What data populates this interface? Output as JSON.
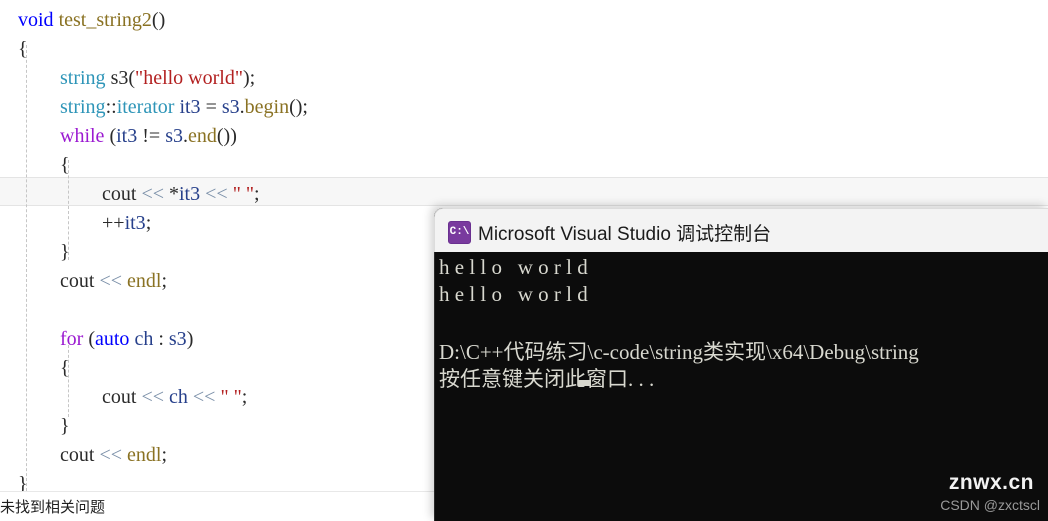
{
  "editor": {
    "language": "cpp",
    "highlighted_line_index": 6,
    "lines": [
      {
        "indent": 0,
        "tokens": [
          {
            "t": "void",
            "c": "kw-blue"
          },
          {
            "t": " ",
            "c": "plain"
          },
          {
            "t": "test_string2",
            "c": "fn-olive"
          },
          {
            "t": "()",
            "c": "punct"
          }
        ]
      },
      {
        "indent": 0,
        "tokens": [
          {
            "t": "{",
            "c": "punct"
          }
        ]
      },
      {
        "indent": 1,
        "tokens": [
          {
            "t": "string",
            "c": "type-cyan"
          },
          {
            "t": " s3",
            "c": "plain"
          },
          {
            "t": "(",
            "c": "punct"
          },
          {
            "t": "\"hello world\"",
            "c": "str-red"
          },
          {
            "t": ");",
            "c": "punct"
          }
        ]
      },
      {
        "indent": 1,
        "tokens": [
          {
            "t": "string",
            "c": "type-cyan"
          },
          {
            "t": "::",
            "c": "punct"
          },
          {
            "t": "iterator",
            "c": "type-cyan"
          },
          {
            "t": " ",
            "c": "plain"
          },
          {
            "t": "it3",
            "c": "ident-navy"
          },
          {
            "t": " = ",
            "c": "punct"
          },
          {
            "t": "s3",
            "c": "ident-navy"
          },
          {
            "t": ".",
            "c": "punct"
          },
          {
            "t": "begin",
            "c": "fn-olive"
          },
          {
            "t": "();",
            "c": "punct"
          }
        ]
      },
      {
        "indent": 1,
        "tokens": [
          {
            "t": "while",
            "c": "kw-purple"
          },
          {
            "t": " (",
            "c": "punct"
          },
          {
            "t": "it3",
            "c": "ident-navy"
          },
          {
            "t": " != ",
            "c": "punct"
          },
          {
            "t": "s3",
            "c": "ident-navy"
          },
          {
            "t": ".",
            "c": "punct"
          },
          {
            "t": "end",
            "c": "fn-olive"
          },
          {
            "t": "())",
            "c": "punct"
          }
        ]
      },
      {
        "indent": 1,
        "tokens": [
          {
            "t": "{",
            "c": "punct"
          }
        ]
      },
      {
        "indent": 2,
        "tokens": [
          {
            "t": "cout",
            "c": "plain"
          },
          {
            "t": " ",
            "c": "plain"
          },
          {
            "t": "<<",
            "c": "op-slate"
          },
          {
            "t": " ",
            "c": "plain"
          },
          {
            "t": "*",
            "c": "punct"
          },
          {
            "t": "it3",
            "c": "ident-navy"
          },
          {
            "t": " ",
            "c": "plain"
          },
          {
            "t": "<<",
            "c": "op-slate"
          },
          {
            "t": " ",
            "c": "plain"
          },
          {
            "t": "\" \"",
            "c": "str-red"
          },
          {
            "t": ";",
            "c": "punct"
          }
        ]
      },
      {
        "indent": 2,
        "tokens": [
          {
            "t": "++",
            "c": "punct"
          },
          {
            "t": "it3",
            "c": "ident-navy"
          },
          {
            "t": ";",
            "c": "punct"
          }
        ]
      },
      {
        "indent": 1,
        "tokens": [
          {
            "t": "}",
            "c": "punct"
          }
        ]
      },
      {
        "indent": 1,
        "tokens": [
          {
            "t": "cout",
            "c": "plain"
          },
          {
            "t": " ",
            "c": "plain"
          },
          {
            "t": "<<",
            "c": "op-slate"
          },
          {
            "t": " ",
            "c": "plain"
          },
          {
            "t": "endl",
            "c": "fn-olive"
          },
          {
            "t": ";",
            "c": "punct"
          }
        ]
      },
      {
        "indent": 0,
        "tokens": [
          {
            "t": "",
            "c": "plain"
          }
        ]
      },
      {
        "indent": 1,
        "tokens": [
          {
            "t": "for",
            "c": "kw-purple"
          },
          {
            "t": " (",
            "c": "punct"
          },
          {
            "t": "auto",
            "c": "kw-blue"
          },
          {
            "t": " ",
            "c": "plain"
          },
          {
            "t": "ch",
            "c": "ident-navy"
          },
          {
            "t": " : ",
            "c": "punct"
          },
          {
            "t": "s3",
            "c": "ident-navy"
          },
          {
            "t": ")",
            "c": "punct"
          }
        ]
      },
      {
        "indent": 1,
        "tokens": [
          {
            "t": "{",
            "c": "punct"
          }
        ]
      },
      {
        "indent": 2,
        "tokens": [
          {
            "t": "cout",
            "c": "plain"
          },
          {
            "t": " ",
            "c": "plain"
          },
          {
            "t": "<<",
            "c": "op-slate"
          },
          {
            "t": " ",
            "c": "plain"
          },
          {
            "t": "ch",
            "c": "ident-navy"
          },
          {
            "t": " ",
            "c": "plain"
          },
          {
            "t": "<<",
            "c": "op-slate"
          },
          {
            "t": " ",
            "c": "plain"
          },
          {
            "t": "\" \"",
            "c": "str-red"
          },
          {
            "t": ";",
            "c": "punct"
          }
        ]
      },
      {
        "indent": 1,
        "tokens": [
          {
            "t": "}",
            "c": "punct"
          }
        ]
      },
      {
        "indent": 1,
        "tokens": [
          {
            "t": "cout",
            "c": "plain"
          },
          {
            "t": " ",
            "c": "plain"
          },
          {
            "t": "<<",
            "c": "op-slate"
          },
          {
            "t": " ",
            "c": "plain"
          },
          {
            "t": "endl",
            "c": "fn-olive"
          },
          {
            "t": ";",
            "c": "punct"
          }
        ]
      },
      {
        "indent": 0,
        "tokens": [
          {
            "t": "}",
            "c": "punct"
          }
        ]
      }
    ]
  },
  "statusbar": {
    "message": "未找到相关问题"
  },
  "console": {
    "icon_name": "cmd-prompt-icon",
    "icon_glyph": "C:\\",
    "title": "Microsoft Visual Studio 调试控制台",
    "lines": [
      "h e l l o   w o r l d ",
      "h e l l o   w o r l d ",
      "",
      "D:\\C++代码练习\\c-code\\string类实现\\x64\\Debug\\string",
      "按任意键关闭此窗口. . ."
    ],
    "cursor_visible": true
  },
  "watermark": {
    "main": "znwx.cn",
    "sub": "CSDN @zxctscl"
  },
  "colors": {
    "keyword_blue": "#0000ff",
    "keyword_purple": "#9b1ad1",
    "type_cyan": "#2e95b8",
    "function_olive": "#8a7223",
    "string_red": "#b32121",
    "identifier_navy": "#27408b",
    "operator_slate": "#7a8fa8",
    "console_bg": "#0c0c0c",
    "console_fg": "#d8d8cf",
    "titlebar_bg": "#f3f3f3",
    "icon_purple": "#793a9e",
    "highlight_line_bg": "#f7f7f7"
  }
}
